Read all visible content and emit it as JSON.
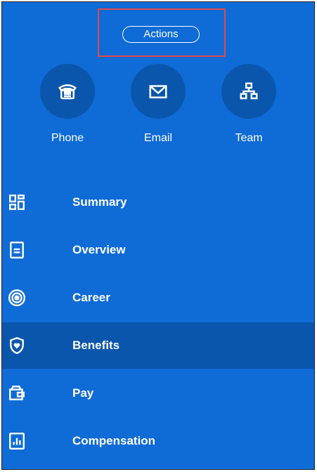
{
  "actions_label": "Actions",
  "quick_actions": [
    {
      "label": "Phone",
      "icon": "phone-icon"
    },
    {
      "label": "Email",
      "icon": "envelope-icon"
    },
    {
      "label": "Team",
      "icon": "org-chart-icon"
    }
  ],
  "nav": {
    "items": [
      {
        "label": "Summary",
        "icon": "dashboard-grid-icon"
      },
      {
        "label": "Overview",
        "icon": "document-icon"
      },
      {
        "label": "Career",
        "icon": "target-icon"
      },
      {
        "label": "Benefits",
        "icon": "shield-heart-icon",
        "selected": true
      },
      {
        "label": "Pay",
        "icon": "wallet-icon"
      },
      {
        "label": "Compensation",
        "icon": "bar-chart-icon"
      }
    ]
  },
  "colors": {
    "panel_bg": "#0f6bd6",
    "selected_bg": "#0a56ad",
    "highlight_border": "#e04a4a",
    "text": "#ffffff"
  }
}
